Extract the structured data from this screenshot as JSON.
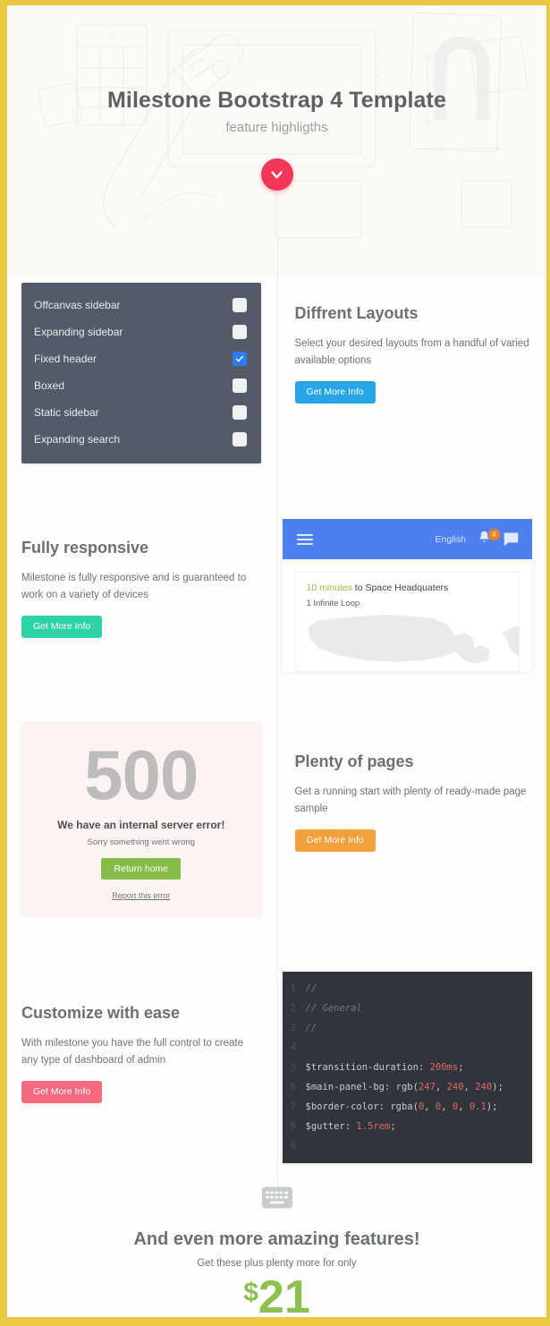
{
  "hero": {
    "title": "Milestone Bootstrap 4 Template",
    "subtitle": "feature highligths",
    "scroll_icon": "chevron-down-icon",
    "scroll_color": "#f23558"
  },
  "layouts_section": {
    "options": [
      {
        "label": "Offcanvas sidebar",
        "checked": false
      },
      {
        "label": "Expanding sidebar",
        "checked": false
      },
      {
        "label": "Fixed header",
        "checked": true
      },
      {
        "label": "Boxed",
        "checked": false
      },
      {
        "label": "Static sidebar",
        "checked": false
      },
      {
        "label": "Expanding search",
        "checked": false
      }
    ],
    "card_bg": "#535b68",
    "checked_color": "#2b7ef0",
    "title": "Diffrent Layouts",
    "text": "Select your desired layouts from a handful of varied available options",
    "button": "Get More Info",
    "button_color": "#28a4e8"
  },
  "responsive_section": {
    "title": "Fully responsive",
    "text": "Milestone is fully responsive and is guaranteed to work on a variety of devices",
    "button": "Get More Info",
    "button_color": "#2ed3a5",
    "mock": {
      "bar_color": "#4d80ef",
      "menu_icon": "hamburger-icon",
      "language": "English",
      "bell_icon": "bell-icon",
      "bell_badge": "4",
      "badge_color": "#f0821e",
      "chat_icon": "chat-bubble-icon",
      "eta_value": "10 minutes",
      "eta_rest": " to Space Headquaters",
      "address": "1 Infinite Loop",
      "map_icon": "us-map-silhouette"
    }
  },
  "pages_section": {
    "error_code": "500",
    "error_heading": "We have an internal server error!",
    "error_text": "Sorry something went wrong",
    "error_button": "Return home",
    "error_button_color": "#86bb4a",
    "error_link": "Report this error",
    "title": "Plenty of pages",
    "text": "Get a running start with plenty of ready-made page sample",
    "button": "Get More Info",
    "button_color": "#f2a03c"
  },
  "customize_section": {
    "title": "Customize with ease",
    "text": "With milestone you have the full control to create any type of dashboard of admin",
    "button": "Get More Info",
    "button_color": "#f4697f",
    "code": {
      "bg": "#30353c",
      "number_color": "#e0685f",
      "lines": [
        {
          "no": "1",
          "parts": [
            {
              "t": "//",
              "c": "com"
            }
          ]
        },
        {
          "no": "2",
          "parts": [
            {
              "t": "// General",
              "c": "com"
            }
          ]
        },
        {
          "no": "3",
          "parts": [
            {
              "t": "//",
              "c": "com"
            }
          ]
        },
        {
          "no": "4",
          "parts": [
            {
              "t": "",
              "c": "txt"
            }
          ]
        },
        {
          "no": "5",
          "parts": [
            {
              "t": "$transition-duration: ",
              "c": "txt"
            },
            {
              "t": "200ms",
              "c": "num"
            },
            {
              "t": ";",
              "c": "txt"
            }
          ]
        },
        {
          "no": "6",
          "parts": [
            {
              "t": "$main-panel-bg: rgb(",
              "c": "txt"
            },
            {
              "t": "247",
              "c": "num"
            },
            {
              "t": ", ",
              "c": "txt"
            },
            {
              "t": "240",
              "c": "num"
            },
            {
              "t": ", ",
              "c": "txt"
            },
            {
              "t": "240",
              "c": "num"
            },
            {
              "t": ");",
              "c": "txt"
            }
          ]
        },
        {
          "no": "7",
          "parts": [
            {
              "t": "$border-color: rgba(",
              "c": "txt"
            },
            {
              "t": "0",
              "c": "num"
            },
            {
              "t": ", ",
              "c": "txt"
            },
            {
              "t": "0",
              "c": "num"
            },
            {
              "t": ", ",
              "c": "txt"
            },
            {
              "t": "0",
              "c": "num"
            },
            {
              "t": ", ",
              "c": "txt"
            },
            {
              "t": "0.1",
              "c": "num"
            },
            {
              "t": ");",
              "c": "txt"
            }
          ]
        },
        {
          "no": "8",
          "parts": [
            {
              "t": "$gutter: ",
              "c": "txt"
            },
            {
              "t": "1.5rem",
              "c": "num"
            },
            {
              "t": ";",
              "c": "txt"
            }
          ]
        },
        {
          "no": "9",
          "parts": [
            {
              "t": "",
              "c": "txt"
            }
          ]
        }
      ]
    }
  },
  "cta": {
    "icon": "keyboard-icon",
    "title": "And even more amazing features!",
    "subtitle": "Get these plus plenty more for only",
    "currency": "$",
    "amount": "21",
    "price_color": "#8cc152"
  },
  "frame": {
    "border_color": "#e8c93f"
  }
}
